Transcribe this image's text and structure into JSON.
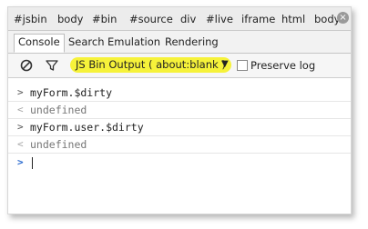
{
  "breadcrumbs": [
    "#jsbin",
    "body",
    "#bin",
    "#source",
    "div",
    "#live",
    "iframe",
    "html",
    "body"
  ],
  "tabs": [
    {
      "label": "Console",
      "active": true
    },
    {
      "label": "Search",
      "active": false
    },
    {
      "label": "Emulation",
      "active": false
    },
    {
      "label": "Rendering",
      "active": false
    }
  ],
  "toolbar": {
    "clear_icon": "no-entry-icon",
    "filter_icon": "funnel-icon",
    "context": "JS Bin Output ( about:blank )",
    "context_highlight": "#f6f23a",
    "preserve_log_label": "Preserve log",
    "preserve_log_checked": false
  },
  "console": {
    "lines": [
      {
        "kind": "command",
        "prompt": ">",
        "text": "myForm.$dirty"
      },
      {
        "kind": "result",
        "prompt": "<",
        "text": "undefined"
      },
      {
        "kind": "command",
        "prompt": ">",
        "text": "myForm.user.$dirty"
      },
      {
        "kind": "result",
        "prompt": "<",
        "text": "undefined"
      }
    ],
    "input_prompt": ">",
    "input_value": ""
  }
}
